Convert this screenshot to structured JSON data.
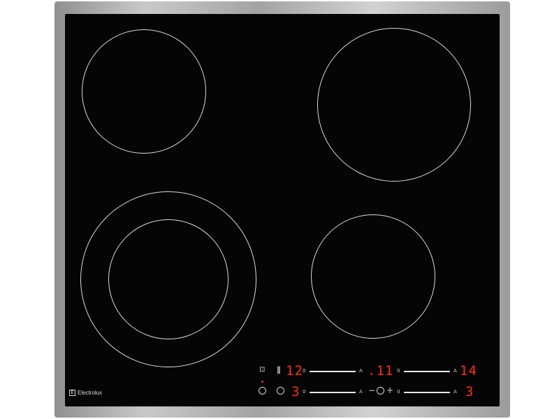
{
  "brand": {
    "name": "Electrolux",
    "logo_glyph": "E"
  },
  "zones": [
    {
      "id": "top-left",
      "rings": 1
    },
    {
      "id": "top-right",
      "rings": 1
    },
    {
      "id": "bottom-left",
      "rings": 2
    },
    {
      "id": "bottom-right",
      "rings": 1
    }
  ],
  "controls": {
    "row1": {
      "pause_icon": "pause-icon",
      "lock_icon": "lock-icon",
      "level_left": "12",
      "slider_left": {
        "min": "0",
        "max": "A"
      },
      "timer_value": ".11",
      "slider_right": {
        "min": "0",
        "max": "A"
      },
      "level_right": "14"
    },
    "row2": {
      "info_icon": "info-icon",
      "bridge_icon": "bridge-icon",
      "level_left": "3",
      "slider_left": {
        "min": "0",
        "max": "A"
      },
      "timer_minus": "−",
      "timer_plus": "+",
      "timer_icon": "timer-icon",
      "slider_right": {
        "min": "0",
        "max": "A"
      },
      "level_right": "3"
    },
    "accent_color": "#ff2a1a"
  }
}
